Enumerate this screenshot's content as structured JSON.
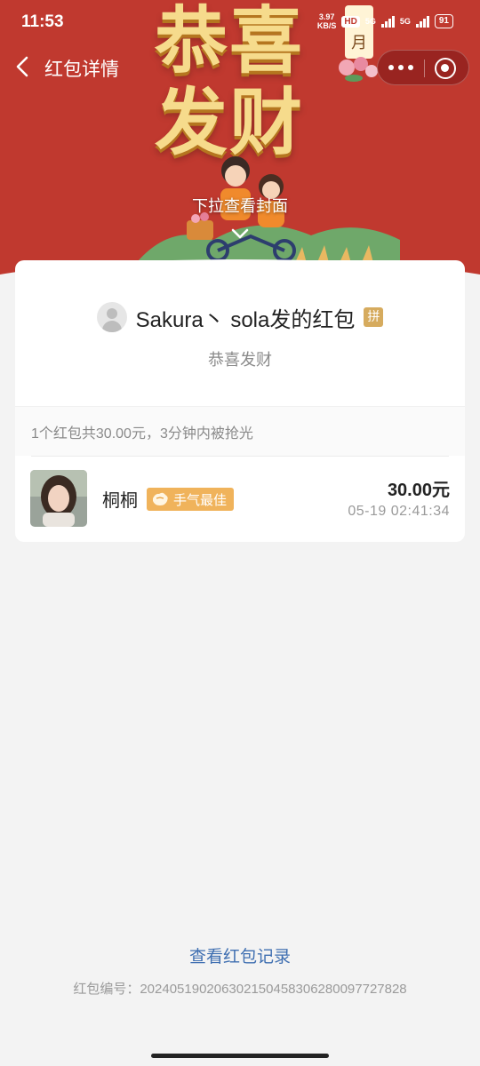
{
  "status_bar": {
    "time": "11:53",
    "net_speed_value": "3.97",
    "net_speed_unit": "KB/S",
    "hd": "HD",
    "network_1": "5G",
    "network_2": "5G",
    "battery": "91"
  },
  "nav": {
    "title": "红包详情"
  },
  "cover": {
    "title_line1": "恭喜",
    "title_line2": "发财",
    "month": "月",
    "pull_hint": "下拉查看封面"
  },
  "packet": {
    "sender": "Sakura丶 sola发的红包",
    "type_badge": "拼",
    "blessing": "恭喜发财",
    "summary": "1个红包共30.00元，3分钟内被抢光"
  },
  "receivers": [
    {
      "name": "桐桐",
      "badge": "手气最佳",
      "amount": "30.00元",
      "time": "05-19 02:41:34"
    }
  ],
  "footer": {
    "record_link": "查看红包记录",
    "serial": "红包编号：20240519020630215045830628009772782​8"
  },
  "colors": {
    "banner_red": "#c0392f",
    "gold_text": "#f6db8c",
    "link_blue": "#3f6fb1",
    "best_badge": "#f0b35b",
    "pin_badge": "#d6ab5e"
  }
}
